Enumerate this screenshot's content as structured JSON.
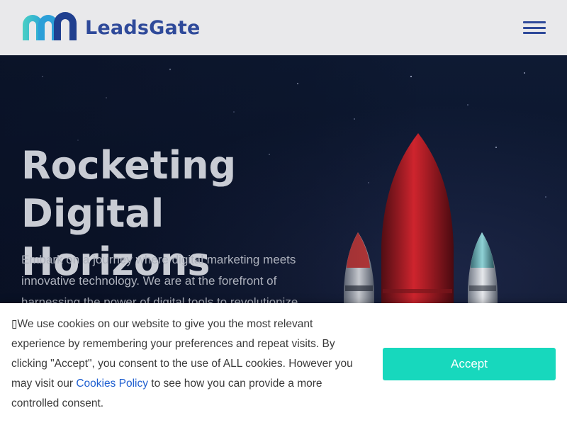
{
  "header": {
    "logo_text": "LeadsGate",
    "menu_icon": "hamburger-menu-icon",
    "brand_color": "#2f4a9a"
  },
  "hero": {
    "title_line1": "Rocketing Digital",
    "title_line2": "Horizons",
    "description": "Embark on a journey where digital marketing meets innovative technology. We are at the forefront of harnessing the power of digital tools to revolutionize",
    "illustration": "rocket-launch-image"
  },
  "cookie_banner": {
    "icon": "cookie-glyph",
    "text_before": "We use cookies on our website to give you the most relevant experience by remembering your preferences and repeat visits. By clicking \"Accept\", you consent to the use of ALL cookies. However you may visit our",
    "link_text": "Cookies Policy",
    "text_after": "to see how you can provide a more controlled consent.",
    "accept_label": "Accept",
    "accent_color": "#17d8bd"
  }
}
